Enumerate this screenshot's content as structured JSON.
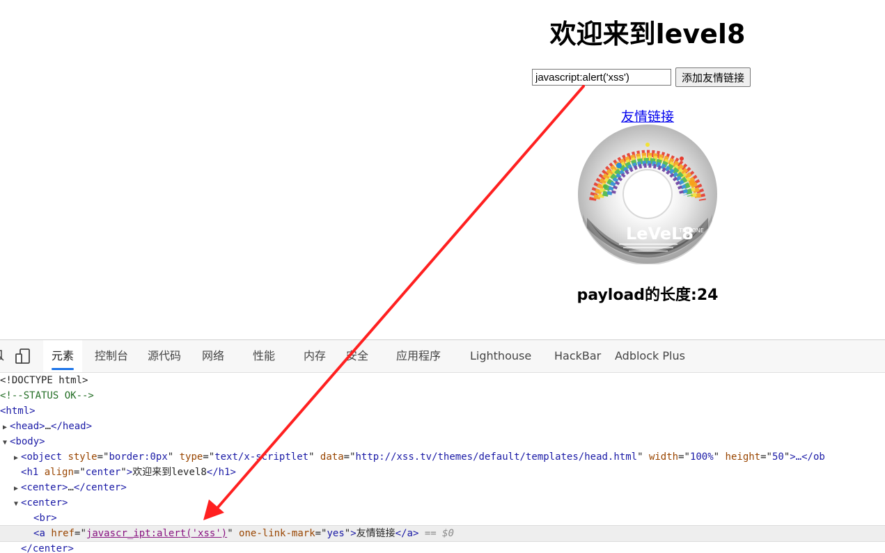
{
  "page": {
    "title": "欢迎来到level8",
    "input_value": "javascript:alert('xss')",
    "add_button_label": "添加友情链接",
    "friend_link_text": "友情链接",
    "cd_label": "LeVeL8",
    "cd_sub": "THE ONE",
    "payload_length_text": "payload的长度:24"
  },
  "devtools": {
    "tabs": [
      {
        "label": "元素",
        "active": true
      },
      {
        "label": "控制台"
      },
      {
        "label": "源代码"
      },
      {
        "label": "网络"
      },
      {
        "label": "性能"
      },
      {
        "label": "内存"
      },
      {
        "label": "安全"
      },
      {
        "label": "应用程序"
      },
      {
        "label": "Lighthouse"
      },
      {
        "label": "HackBar"
      },
      {
        "label": "Adblock Plus"
      }
    ],
    "dom": {
      "doctype": "<!DOCTYPE html>",
      "comment": "<!--STATUS OK-->",
      "html_open": "<html>",
      "head": "head",
      "ellipsis": "…",
      "body": "body",
      "object_tag": "object",
      "object_style_attr": "style",
      "object_style_val": "border:0px",
      "object_type_attr": "type",
      "object_type_val": "text/x-scriptlet",
      "object_data_attr": "data",
      "object_data_val": "http://xss.tv/themes/default/templates/head.html",
      "object_width_attr": "width",
      "object_width_val": "100%",
      "object_height_attr": "height",
      "object_height_val": "50",
      "object_tail": "…</ob",
      "h1_tag": "h1",
      "h1_align_attr": "align",
      "h1_align_val": "center",
      "h1_text": "欢迎来到level8",
      "center_tag": "center",
      "br_tag": "br",
      "a_tag": "a",
      "a_href_attr": "href",
      "a_href_val": "javascr_ipt:alert('xss')",
      "a_mark_attr": "one-link-mark",
      "a_mark_val": "yes",
      "a_text": "友情链接",
      "dollar0": "== $0"
    }
  },
  "colors": {
    "link": "#0000ee",
    "tab_indicator": "#1a73e8",
    "arrow": "#ff2020"
  }
}
